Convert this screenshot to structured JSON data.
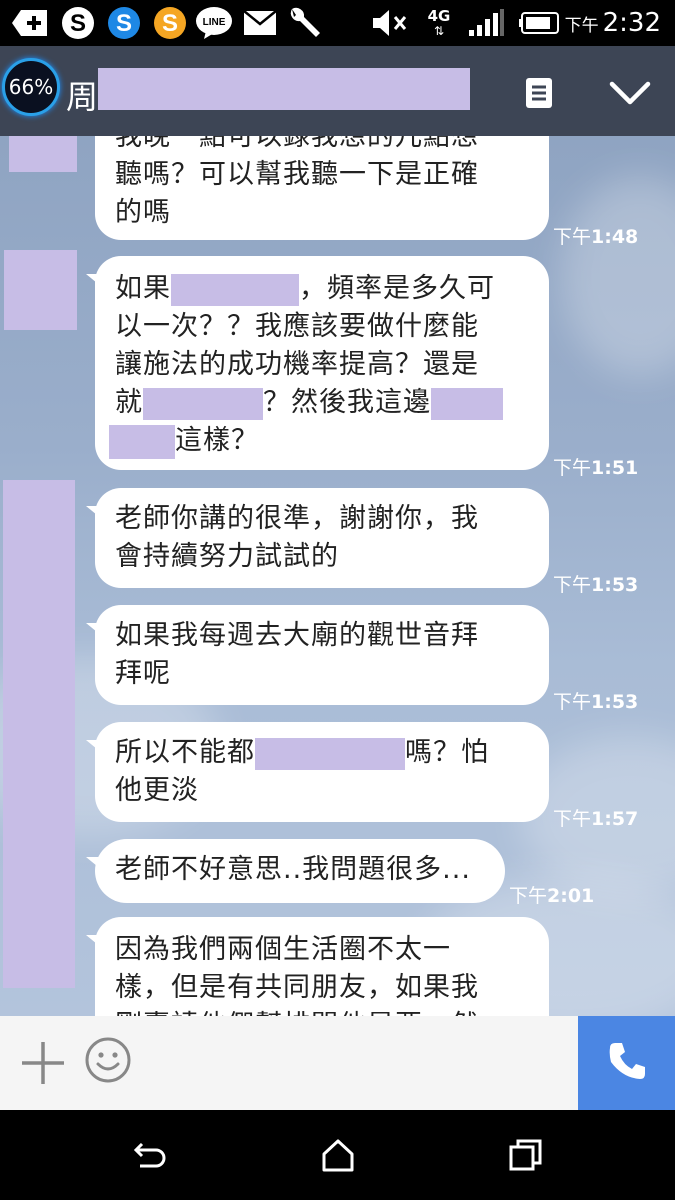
{
  "status_bar": {
    "icons": [
      "plus-icon",
      "skype-icon",
      "s-app-icon",
      "s-app-orange-icon",
      "line-icon",
      "mail-icon",
      "wrench-icon",
      "mute-icon",
      "network-4g-icon",
      "signal-icon",
      "battery-icon"
    ],
    "line_label": "LINE",
    "network": "4G",
    "time_ampm": "下午",
    "time": "2:32"
  },
  "header": {
    "battery_badge": "66%",
    "chat_title": "周"
  },
  "messages": [
    {
      "text_line1": "我晚一點可以錄我想的儿點想",
      "text_line2": "聽嗎？可以幫我聽一下是正確",
      "text_line3": "的嗎",
      "time_ampm": "下午",
      "time": "1:48"
    },
    {
      "seg1": "如果",
      "seg2": "，頻率是多久可",
      "line2": "以一次？？我應該要做什麼能",
      "line3": "讓施法的成功機率提高？還是",
      "seg3": "就",
      "seg4": "？然後我這邊",
      "seg5": "這樣？",
      "time_ampm": "下午",
      "time": "1:51"
    },
    {
      "line1": "老師你講的很準，謝謝你，我",
      "line2": "會持續努力試試的",
      "time_ampm": "下午",
      "time": "1:53"
    },
    {
      "line1": "如果我每週去大廟的觀世音拜",
      "line2": "拜呢",
      "time_ampm": "下午",
      "time": "1:53"
    },
    {
      "seg1": "所以不能都",
      "seg2": "嗎？怕",
      "line2": "他更淡",
      "time_ampm": "下午",
      "time": "1:57"
    },
    {
      "line1": "老師不好意思..我問題很多...",
      "time_ampm": "下午",
      "time": "2:01"
    },
    {
      "line1": "因為我們兩個生活圈不太一",
      "line2": "樣，但是有共同朋友，如果我",
      "line3": "剛賣請他們幫排開他是要，然"
    }
  ],
  "input_bar": {
    "plus_icon": "plus-icon",
    "emoji_icon": "emoji-icon",
    "call_icon": "phone-icon",
    "call_color": "#4b86e3"
  },
  "nav_bar": [
    "back-icon",
    "home-icon",
    "recents-icon"
  ]
}
